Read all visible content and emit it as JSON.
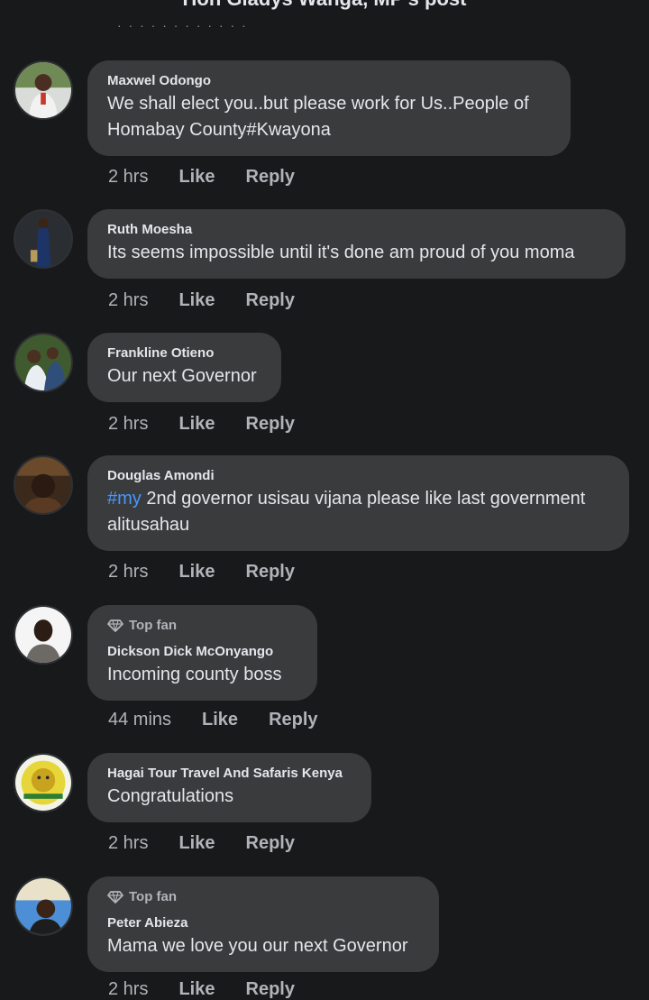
{
  "header": {
    "title": "Hon Gladys Wanga, MP's post",
    "subtitle": "· · · · · · · · · · · ·"
  },
  "comments": [
    {
      "name": "Maxwel Odongo",
      "badge": "",
      "text": "We shall elect you..but please work for Us..People of Homabay County#Kwayona",
      "time": "2 hrs",
      "like": "Like",
      "reply": "Reply"
    },
    {
      "name": "Ruth Moesha",
      "badge": "",
      "text": "Its seems impossible until it's done am proud of you moma",
      "time": "2 hrs",
      "like": "Like",
      "reply": "Reply"
    },
    {
      "name": "Frankline Otieno",
      "badge": "",
      "text": "Our next Governor",
      "time": "2 hrs",
      "like": "Like",
      "reply": "Reply"
    },
    {
      "name": "Douglas Amondi",
      "badge": "",
      "hashtag": "#my",
      "text": " 2nd governor usisau vijana please like last government alitusahau",
      "time": "2 hrs",
      "like": "Like",
      "reply": "Reply"
    },
    {
      "name": "Dickson Dick McOnyango",
      "badge": "Top fan",
      "text": "Incoming county boss",
      "time": "44 mins",
      "like": "Like",
      "reply": "Reply"
    },
    {
      "name": "Hagai Tour Travel And Safaris Kenya",
      "badge": "",
      "text": "Congratulations",
      "time": "2 hrs",
      "like": "Like",
      "reply": "Reply"
    },
    {
      "name": "Peter Abieza",
      "badge": "Top fan",
      "text": "Mama we love you our next Governor",
      "time": "2 hrs",
      "like": "Like",
      "reply": "Reply"
    }
  ],
  "colors": {
    "background": "#18191a",
    "bubble": "#3a3b3c",
    "hashtag": "#4599ff",
    "meta": "#b0b3b8"
  }
}
